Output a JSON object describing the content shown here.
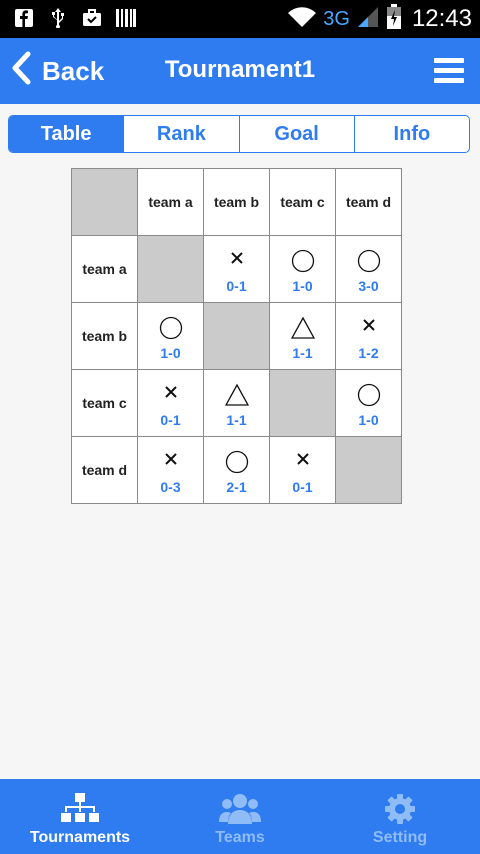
{
  "status_bar": {
    "network": "3G",
    "time": "12:43"
  },
  "header": {
    "back_label": "Back",
    "title": "Tournament1"
  },
  "tabs": [
    {
      "label": "Table",
      "active": true
    },
    {
      "label": "Rank",
      "active": false
    },
    {
      "label": "Goal",
      "active": false
    },
    {
      "label": "Info",
      "active": false
    }
  ],
  "matrix": {
    "teams": [
      "team a",
      "team b",
      "team c",
      "team d"
    ],
    "rows": [
      {
        "team": "team a",
        "cells": [
          {
            "self": true
          },
          {
            "symbol": "loss",
            "score": "0-1"
          },
          {
            "symbol": "win",
            "score": "1-0"
          },
          {
            "symbol": "win",
            "score": "3-0"
          }
        ]
      },
      {
        "team": "team b",
        "cells": [
          {
            "symbol": "win",
            "score": "1-0"
          },
          {
            "self": true
          },
          {
            "symbol": "draw",
            "score": "1-1"
          },
          {
            "symbol": "loss",
            "score": "1-2"
          }
        ]
      },
      {
        "team": "team c",
        "cells": [
          {
            "symbol": "loss",
            "score": "0-1"
          },
          {
            "symbol": "draw",
            "score": "1-1"
          },
          {
            "self": true
          },
          {
            "symbol": "win",
            "score": "1-0"
          }
        ]
      },
      {
        "team": "team d",
        "cells": [
          {
            "symbol": "loss",
            "score": "0-3"
          },
          {
            "symbol": "win",
            "score": "2-1"
          },
          {
            "symbol": "loss",
            "score": "0-1"
          },
          {
            "self": true
          }
        ]
      }
    ]
  },
  "bottom_nav": [
    {
      "label": "Tournaments",
      "icon": "tournament-bracket-icon",
      "active": true
    },
    {
      "label": "Teams",
      "icon": "team-people-icon",
      "active": false
    },
    {
      "label": "Setting",
      "icon": "gear-icon",
      "active": false
    }
  ],
  "colors": {
    "accent": "#2f7cf0",
    "inactive_nav": "#8fbcf6",
    "self_cell": "#cbcbcb"
  }
}
